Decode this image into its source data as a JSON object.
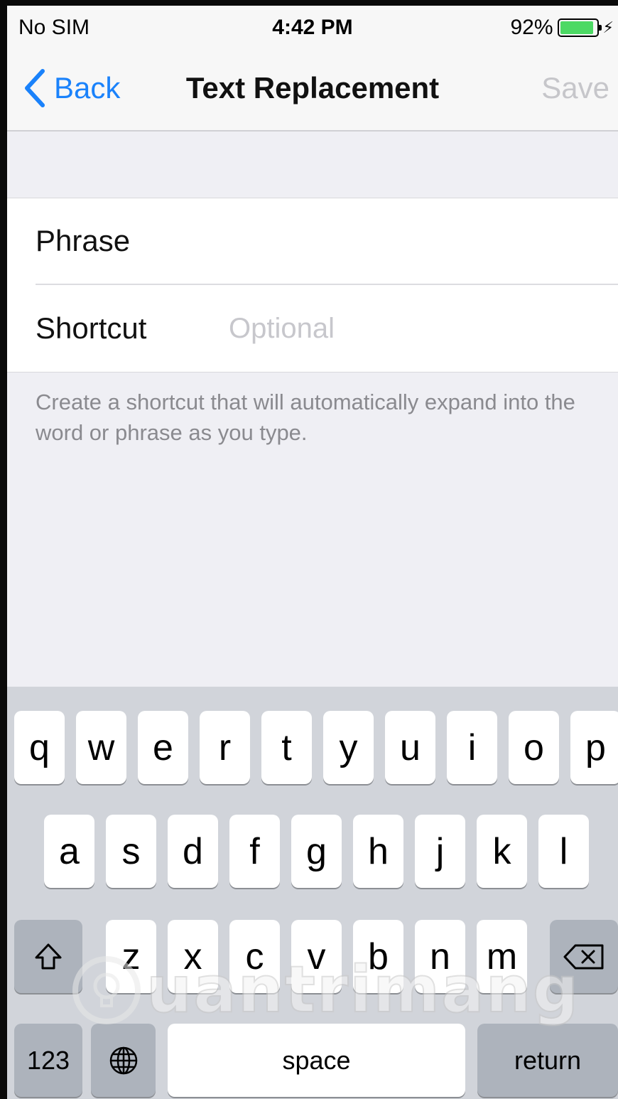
{
  "status_bar": {
    "carrier": "No SIM",
    "time": "4:42 PM",
    "battery_percent": "92%",
    "battery_level": 0.92,
    "battery_color": "#4cd964",
    "charging_icon": "bolt-icon"
  },
  "nav": {
    "back_label": "Back",
    "title": "Text Replacement",
    "save_label": "Save",
    "accent_color": "#1a82fb"
  },
  "form": {
    "phrase_label": "Phrase",
    "phrase_value": "",
    "shortcut_label": "Shortcut",
    "shortcut_placeholder": "Optional",
    "shortcut_value": ""
  },
  "footer": {
    "text": "Create a shortcut that will automatically expand into the word or phrase as you type."
  },
  "keyboard": {
    "row1": [
      "q",
      "w",
      "e",
      "r",
      "t",
      "y",
      "u",
      "i",
      "o",
      "p"
    ],
    "row2": [
      "a",
      "s",
      "d",
      "f",
      "g",
      "h",
      "j",
      "k",
      "l"
    ],
    "row3": [
      "z",
      "x",
      "c",
      "v",
      "b",
      "n",
      "m"
    ],
    "numbers_label": "123",
    "space_label": "space",
    "return_label": "return",
    "shift_icon": "shift-icon",
    "delete_icon": "delete-icon",
    "globe_icon": "globe-icon"
  },
  "watermark": {
    "text": "uantrimang",
    "icon": "lightbulb-icon"
  }
}
